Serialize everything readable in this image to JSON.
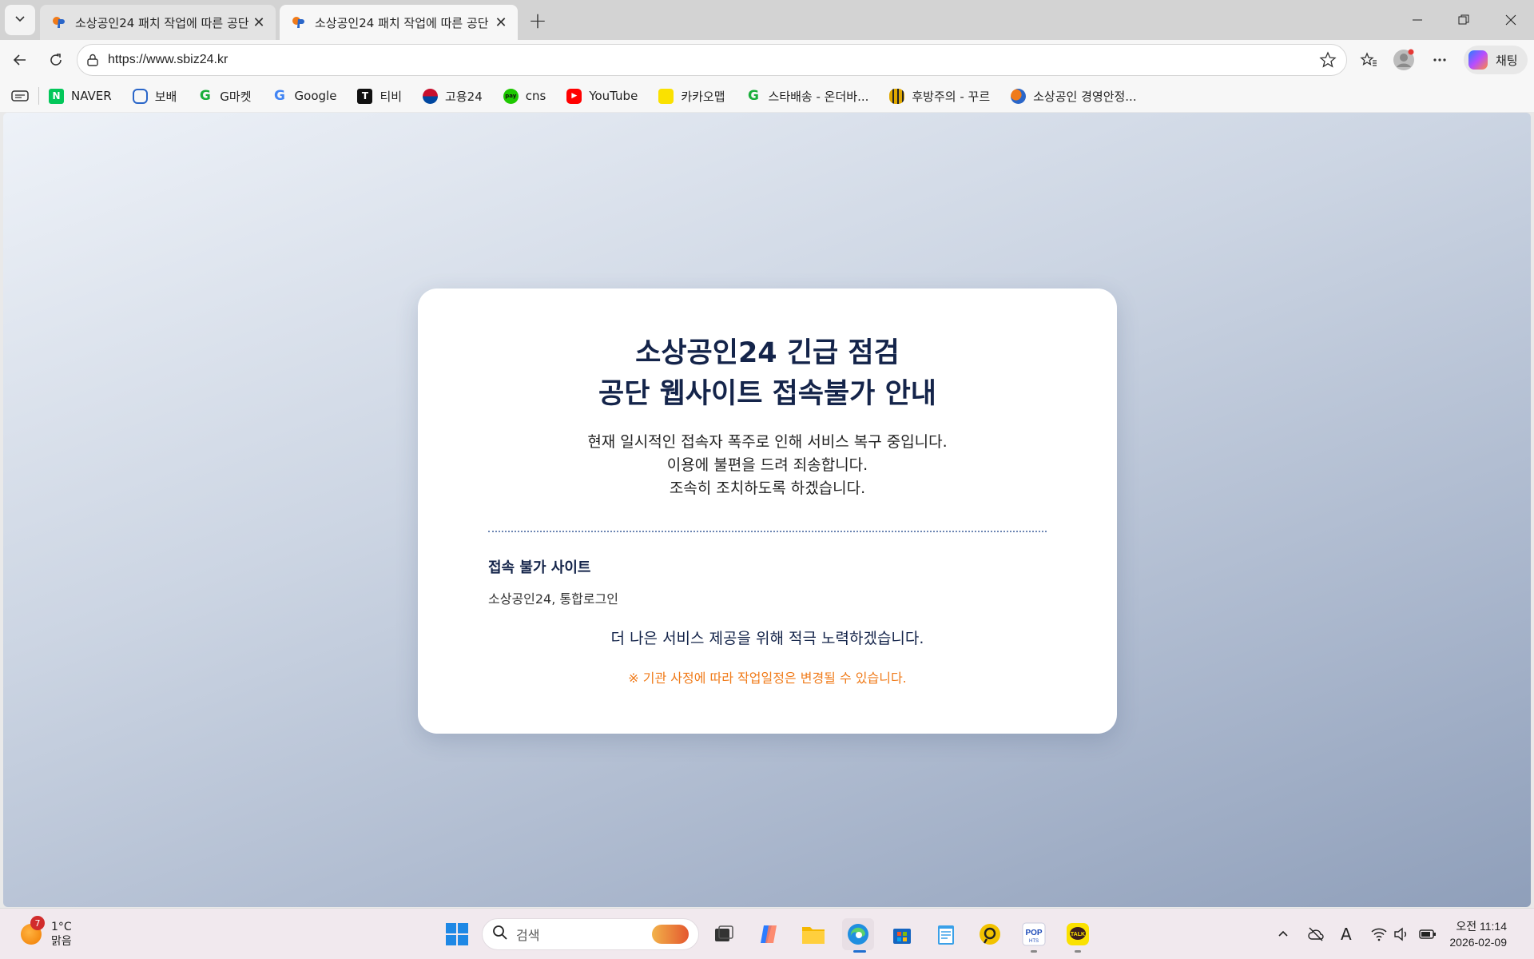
{
  "browser": {
    "tabs": [
      {
        "title": "소상공인24 패치 작업에 따른 공단",
        "active": false
      },
      {
        "title": "소상공인24 패치 작업에 따른 공단",
        "active": true
      }
    ],
    "url": "https://www.sbiz24.kr",
    "copilot_label": "채팅"
  },
  "bookmarks": [
    {
      "label": "NAVER",
      "icon": "naver-icon",
      "color": "#03c75a"
    },
    {
      "label": "보배",
      "icon": "car-icon",
      "color": "#2a66c9"
    },
    {
      "label": "G마켓",
      "icon": "gmarket-icon",
      "color": "#1aae3b"
    },
    {
      "label": "Google",
      "icon": "google-icon",
      "color": "#4285f4"
    },
    {
      "label": "티비",
      "icon": "t-icon",
      "color": "#111111"
    },
    {
      "label": "고용24",
      "icon": "korea-icon",
      "color": "#c8102e"
    },
    {
      "label": "cns",
      "icon": "pay-icon",
      "color": "#1ec800"
    },
    {
      "label": "YouTube",
      "icon": "youtube-icon",
      "color": "#ff0000"
    },
    {
      "label": "카카오맵",
      "icon": "kakaomap-icon",
      "color": "#fae100"
    },
    {
      "label": "스타배송 - 온더바...",
      "icon": "g-icon",
      "color": "#1aae3b"
    },
    {
      "label": "후방주의 - 꾸르",
      "icon": "bee-icon",
      "color": "#e0a800"
    },
    {
      "label": "소상공인 경영안정...",
      "icon": "sbiz-icon",
      "color": "#f07b1a"
    }
  ],
  "page": {
    "title_line1": "소상공인24 긴급 점검",
    "title_line2": "공단 웹사이트 접속불가 안내",
    "desc_line1": "현재 일시적인 접속자 폭주로 인해 서비스 복구 중입니다.",
    "desc_line2": "이용에 불편을 드려 죄송합니다.",
    "desc_line3": "조속히 조치하도록 하겠습니다.",
    "section_title": "접속 불가 사이트",
    "section_body": "소상공인24, 통합로그인",
    "closing": "더 나은 서비스 제공을 위해 적극 노력하겠습니다.",
    "notice": "※ 기관 사정에 따라 작업일정은 변경될 수 있습니다."
  },
  "taskbar": {
    "weather_badge": "7",
    "weather_temp": "1°C",
    "weather_cond": "맑음",
    "search_placeholder": "검색",
    "time": "오전 11:14",
    "date": "2026-02-09",
    "ime": "A"
  }
}
